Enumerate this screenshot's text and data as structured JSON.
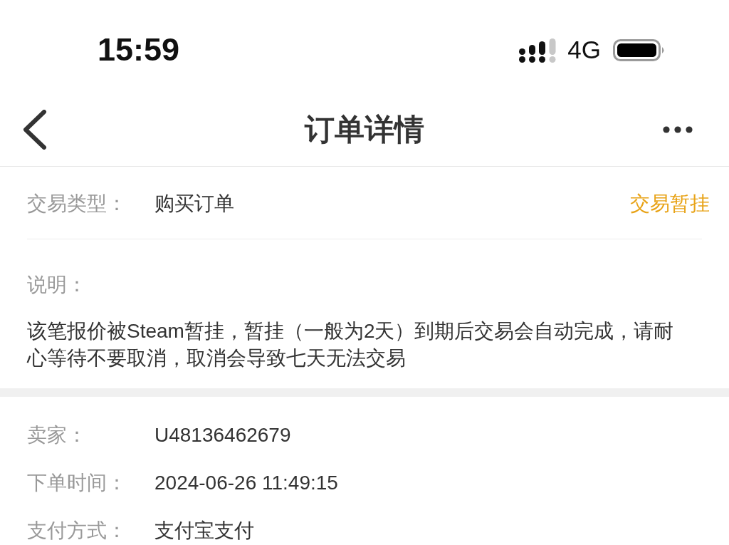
{
  "status_bar": {
    "time": "15:59",
    "network": "4G"
  },
  "nav_bar": {
    "title": "订单详情"
  },
  "trade": {
    "label": "交易类型：",
    "value": "购买订单",
    "status": "交易暂挂"
  },
  "note": {
    "label": "说明：",
    "text": "该笔报价被Steam暂挂，暂挂（一般为2天）到期后交易会自动完成，请耐心等待不要取消，取消会导致七天无法交易"
  },
  "details": [
    {
      "label": "卖家：",
      "value": "U48136462679"
    },
    {
      "label": "下单时间：",
      "value": "2024-06-26 11:49:15"
    },
    {
      "label": "支付方式：",
      "value": "支付宝支付"
    }
  ]
}
